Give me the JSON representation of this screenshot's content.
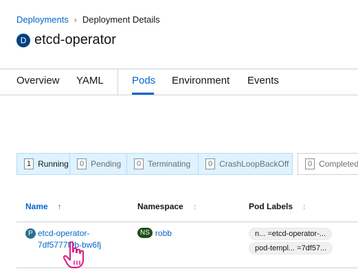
{
  "breadcrumb": {
    "parent": "Deployments",
    "current": "Deployment Details"
  },
  "header": {
    "badge": "D",
    "title": "etcd-operator"
  },
  "tabs": [
    {
      "label": "Overview",
      "active": false
    },
    {
      "label": "YAML",
      "active": false
    },
    {
      "label": "Pods",
      "active": true
    },
    {
      "label": "Environment",
      "active": false
    },
    {
      "label": "Events",
      "active": false
    }
  ],
  "filters": [
    {
      "count": "1",
      "label": "Running"
    },
    {
      "count": "0",
      "label": "Pending"
    },
    {
      "count": "0",
      "label": "Terminating"
    },
    {
      "count": "0",
      "label": "CrashLoopBackOff"
    },
    {
      "count": "0",
      "label": "Completed"
    }
  ],
  "table": {
    "columns": [
      "Name",
      "Namespace",
      "Pod Labels"
    ],
    "rows": [
      {
        "badge": "P",
        "name": "etcd-operator-7df5777f9b-bw6fj",
        "ns_badge": "NS",
        "namespace": "robb",
        "labels": [
          "n... =etcd-operator-...",
          "pod-templ... =7df57..."
        ]
      }
    ]
  },
  "colors": {
    "link": "#0066cc",
    "filter_bg": "#def3ff",
    "pod_badge": "#2b6f92",
    "ns_badge": "#1e4f18",
    "cursor": "#e0218a"
  }
}
